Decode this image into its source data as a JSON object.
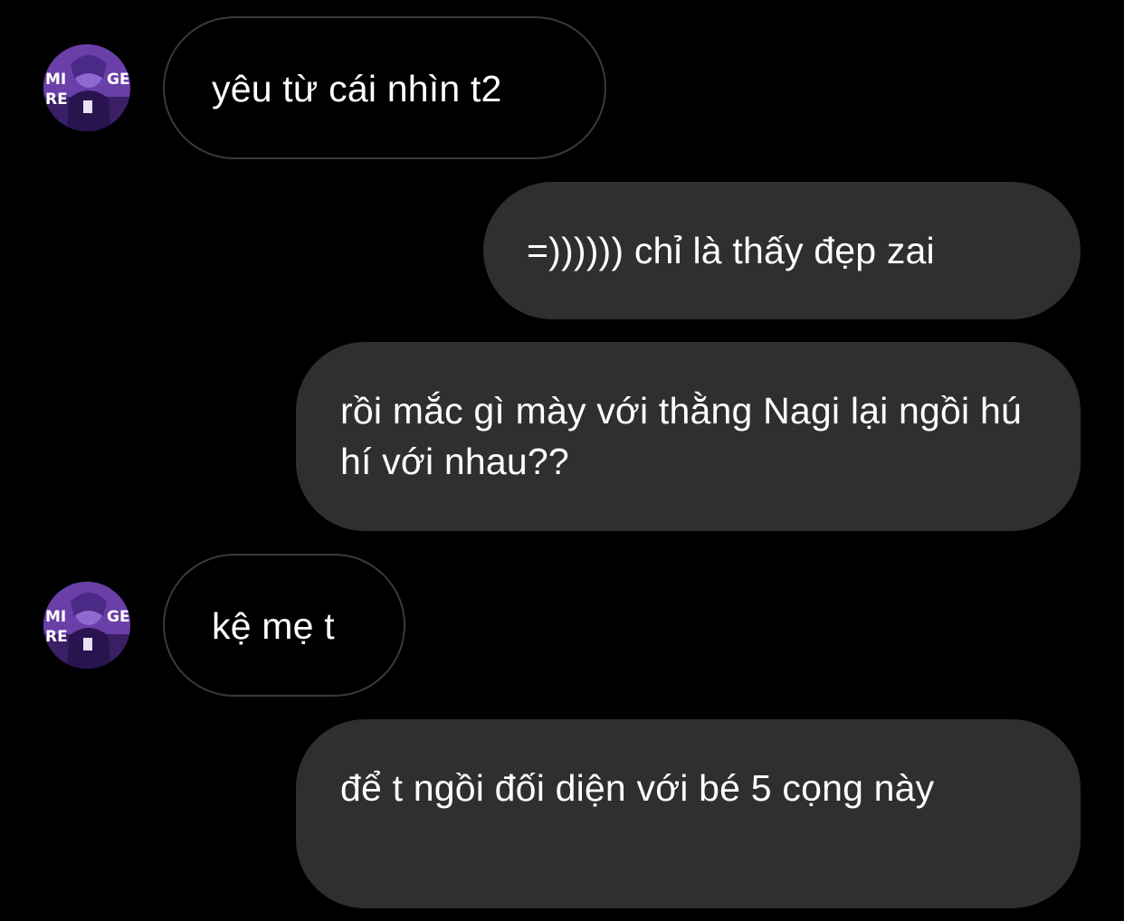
{
  "colors": {
    "background": "#000000",
    "outgoing_bubble": "#2f2f2f",
    "incoming_border": "#3a3a3a",
    "text": "#ffffff",
    "avatar_accent": "#6a3fa8"
  },
  "contact": {
    "avatar_icon": "anime-character-avatar",
    "avatar_text_lines": [
      "MI",
      "GE",
      "RE"
    ]
  },
  "messages": [
    {
      "direction": "incoming",
      "text": "yêu từ cái nhìn t2"
    },
    {
      "direction": "outgoing",
      "text": "=)))))) chỉ là thấy đẹp zai"
    },
    {
      "direction": "outgoing",
      "text": "rồi mắc gì mày với thằng Nagi lại ngồi hú hí với nhau??"
    },
    {
      "direction": "incoming",
      "text": "kệ mẹ t"
    },
    {
      "direction": "outgoing",
      "text": "để t ngồi đối diện với bé 5 cọng này"
    }
  ]
}
